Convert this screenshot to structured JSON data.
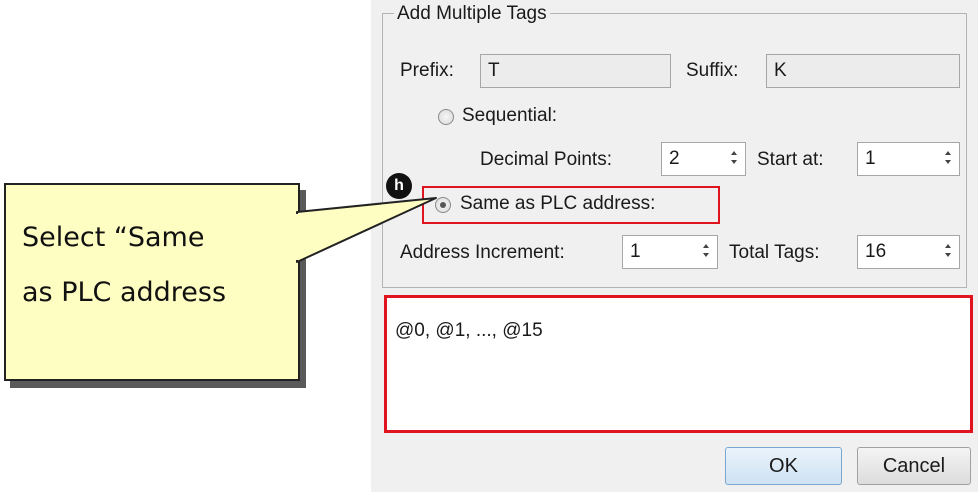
{
  "dialog": {
    "group_title": "Add Multiple Tags",
    "prefix_label": "Prefix:",
    "prefix_value": "T",
    "suffix_label": "Suffix:",
    "suffix_value": "K",
    "sequential_label": "Sequential:",
    "decimal_points_label": "Decimal Points:",
    "decimal_points_value": "2",
    "start_at_label": "Start at:",
    "start_at_value": "1",
    "same_as_plc_label": "Same as PLC address:",
    "address_increment_label": "Address Increment:",
    "address_increment_value": "1",
    "total_tags_label": "Total Tags:",
    "total_tags_value": "16",
    "preview_text": "@0, @1, ..., @15",
    "ok_label": "OK",
    "cancel_label": "Cancel",
    "selected_mode": "same_as_plc_address"
  },
  "annotation": {
    "step_badge": "h",
    "callout_text": "Select  “Same\nas PLC address",
    "highlight_color": "#e0141e",
    "callout_color": "#fffec2"
  }
}
